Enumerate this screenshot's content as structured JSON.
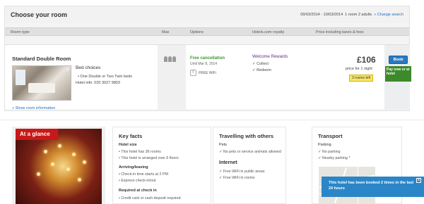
{
  "header": {
    "title": "Choose your room",
    "dates": "09/03/2014 - 10/03/2014",
    "rooms_adults": "1 room 2 adults",
    "change_search": "Change search"
  },
  "columns": [
    "Room type",
    "Max",
    "Options",
    "Hotels.com royalty",
    "Price including taxes & fees"
  ],
  "room": {
    "name": "Standard Double Room",
    "bed_choices_label": "Bed choices",
    "bed_option": "One Double or Two Twin beds",
    "hotel_info": "Hotel info: 020 3027 9803",
    "show_room_info": "Show room information",
    "free_cancellation": "Free cancellation",
    "cancel_until": "Until Mar 8, 2014",
    "wifi_label": "FREE WiFi",
    "rewards_title": "Welcome Rewards",
    "rewards_items": [
      "Collect",
      "Redeem"
    ],
    "price": "£106",
    "price_note": "price for 1 night",
    "rooms_left": "3 rooms left",
    "book_label": "Book",
    "pay_badge": "Pay now or at hotel"
  },
  "glance": {
    "label": "At a glance"
  },
  "key_facts": {
    "title": "Key facts",
    "hotel_size_label": "Hotel size",
    "hotel_size_items": [
      "This hotel has 36 rooms",
      "This hotel is arranged over 6 floors"
    ],
    "arriving_label": "Arriving/leaving",
    "arriving_items": [
      "Check-in time starts at 2 PM",
      "Express check-in/out"
    ],
    "required_label": "Required at check in",
    "required_items": [
      "Credit card or cash deposit required"
    ]
  },
  "travelling": {
    "title": "Travelling with others",
    "pets_label": "Pets",
    "pets_items": [
      "No pets or service animals allowed"
    ],
    "internet_label": "Internet",
    "internet_items": [
      "Free WiFi in public areas",
      "Free WiFi in rooms"
    ]
  },
  "transport": {
    "title": "Transport",
    "parking_label": "Parking",
    "parking_items": [
      "No parking",
      "Nearby parking *"
    ]
  },
  "notice": {
    "text": "This hotel has been booked 2 times in the last 24 hours",
    "close": "x"
  },
  "colors": {
    "link": "#1d6fc7",
    "book_button": "#2b79c2",
    "pay_badge": "#3c8a2a",
    "free_cancel": "#3a9a2a",
    "rewards": "#6a2a83",
    "glance_label": "#c81818",
    "notice": "#2b86c8"
  }
}
